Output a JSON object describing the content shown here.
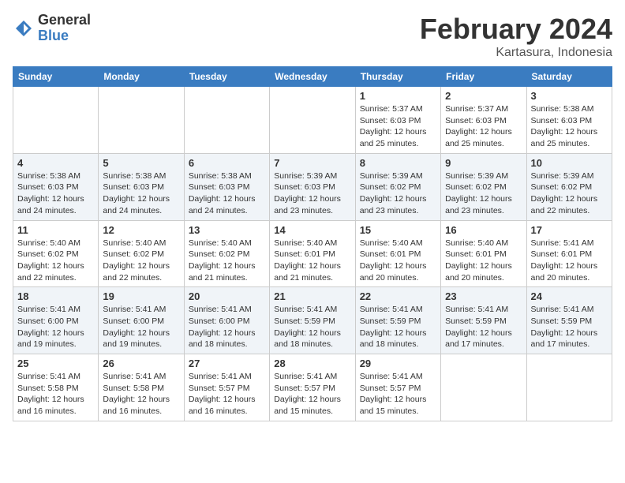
{
  "logo": {
    "general": "General",
    "blue": "Blue"
  },
  "header": {
    "title": "February 2024",
    "location": "Kartasura, Indonesia"
  },
  "weekdays": [
    "Sunday",
    "Monday",
    "Tuesday",
    "Wednesday",
    "Thursday",
    "Friday",
    "Saturday"
  ],
  "weeks": [
    [
      {
        "day": "",
        "info": ""
      },
      {
        "day": "",
        "info": ""
      },
      {
        "day": "",
        "info": ""
      },
      {
        "day": "",
        "info": ""
      },
      {
        "day": "1",
        "info": "Sunrise: 5:37 AM\nSunset: 6:03 PM\nDaylight: 12 hours\nand 25 minutes."
      },
      {
        "day": "2",
        "info": "Sunrise: 5:37 AM\nSunset: 6:03 PM\nDaylight: 12 hours\nand 25 minutes."
      },
      {
        "day": "3",
        "info": "Sunrise: 5:38 AM\nSunset: 6:03 PM\nDaylight: 12 hours\nand 25 minutes."
      }
    ],
    [
      {
        "day": "4",
        "info": "Sunrise: 5:38 AM\nSunset: 6:03 PM\nDaylight: 12 hours\nand 24 minutes."
      },
      {
        "day": "5",
        "info": "Sunrise: 5:38 AM\nSunset: 6:03 PM\nDaylight: 12 hours\nand 24 minutes."
      },
      {
        "day": "6",
        "info": "Sunrise: 5:38 AM\nSunset: 6:03 PM\nDaylight: 12 hours\nand 24 minutes."
      },
      {
        "day": "7",
        "info": "Sunrise: 5:39 AM\nSunset: 6:03 PM\nDaylight: 12 hours\nand 23 minutes."
      },
      {
        "day": "8",
        "info": "Sunrise: 5:39 AM\nSunset: 6:02 PM\nDaylight: 12 hours\nand 23 minutes."
      },
      {
        "day": "9",
        "info": "Sunrise: 5:39 AM\nSunset: 6:02 PM\nDaylight: 12 hours\nand 23 minutes."
      },
      {
        "day": "10",
        "info": "Sunrise: 5:39 AM\nSunset: 6:02 PM\nDaylight: 12 hours\nand 22 minutes."
      }
    ],
    [
      {
        "day": "11",
        "info": "Sunrise: 5:40 AM\nSunset: 6:02 PM\nDaylight: 12 hours\nand 22 minutes."
      },
      {
        "day": "12",
        "info": "Sunrise: 5:40 AM\nSunset: 6:02 PM\nDaylight: 12 hours\nand 22 minutes."
      },
      {
        "day": "13",
        "info": "Sunrise: 5:40 AM\nSunset: 6:02 PM\nDaylight: 12 hours\nand 21 minutes."
      },
      {
        "day": "14",
        "info": "Sunrise: 5:40 AM\nSunset: 6:01 PM\nDaylight: 12 hours\nand 21 minutes."
      },
      {
        "day": "15",
        "info": "Sunrise: 5:40 AM\nSunset: 6:01 PM\nDaylight: 12 hours\nand 20 minutes."
      },
      {
        "day": "16",
        "info": "Sunrise: 5:40 AM\nSunset: 6:01 PM\nDaylight: 12 hours\nand 20 minutes."
      },
      {
        "day": "17",
        "info": "Sunrise: 5:41 AM\nSunset: 6:01 PM\nDaylight: 12 hours\nand 20 minutes."
      }
    ],
    [
      {
        "day": "18",
        "info": "Sunrise: 5:41 AM\nSunset: 6:00 PM\nDaylight: 12 hours\nand 19 minutes."
      },
      {
        "day": "19",
        "info": "Sunrise: 5:41 AM\nSunset: 6:00 PM\nDaylight: 12 hours\nand 19 minutes."
      },
      {
        "day": "20",
        "info": "Sunrise: 5:41 AM\nSunset: 6:00 PM\nDaylight: 12 hours\nand 18 minutes."
      },
      {
        "day": "21",
        "info": "Sunrise: 5:41 AM\nSunset: 5:59 PM\nDaylight: 12 hours\nand 18 minutes."
      },
      {
        "day": "22",
        "info": "Sunrise: 5:41 AM\nSunset: 5:59 PM\nDaylight: 12 hours\nand 18 minutes."
      },
      {
        "day": "23",
        "info": "Sunrise: 5:41 AM\nSunset: 5:59 PM\nDaylight: 12 hours\nand 17 minutes."
      },
      {
        "day": "24",
        "info": "Sunrise: 5:41 AM\nSunset: 5:59 PM\nDaylight: 12 hours\nand 17 minutes."
      }
    ],
    [
      {
        "day": "25",
        "info": "Sunrise: 5:41 AM\nSunset: 5:58 PM\nDaylight: 12 hours\nand 16 minutes."
      },
      {
        "day": "26",
        "info": "Sunrise: 5:41 AM\nSunset: 5:58 PM\nDaylight: 12 hours\nand 16 minutes."
      },
      {
        "day": "27",
        "info": "Sunrise: 5:41 AM\nSunset: 5:57 PM\nDaylight: 12 hours\nand 16 minutes."
      },
      {
        "day": "28",
        "info": "Sunrise: 5:41 AM\nSunset: 5:57 PM\nDaylight: 12 hours\nand 15 minutes."
      },
      {
        "day": "29",
        "info": "Sunrise: 5:41 AM\nSunset: 5:57 PM\nDaylight: 12 hours\nand 15 minutes."
      },
      {
        "day": "",
        "info": ""
      },
      {
        "day": "",
        "info": ""
      }
    ]
  ]
}
